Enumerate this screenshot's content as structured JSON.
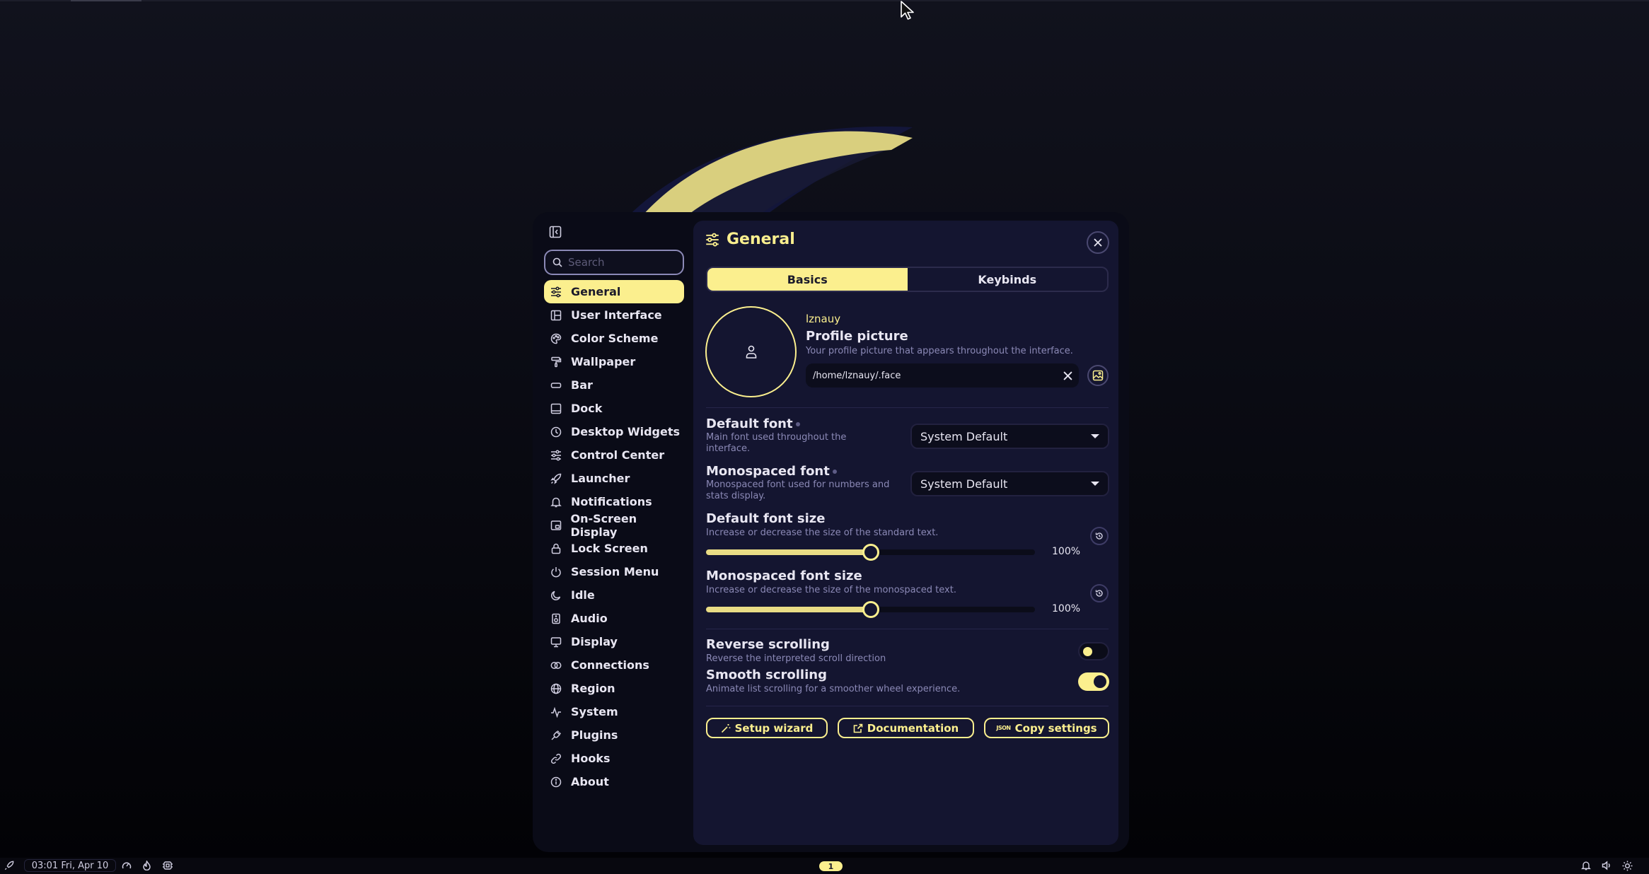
{
  "sidebar": {
    "search": {
      "placeholder": "Search"
    },
    "items": [
      {
        "label": "General",
        "icon": "sliders-icon"
      },
      {
        "label": "User Interface",
        "icon": "layout-icon"
      },
      {
        "label": "Color Scheme",
        "icon": "palette-icon"
      },
      {
        "label": "Wallpaper",
        "icon": "brush-icon"
      },
      {
        "label": "Bar",
        "icon": "bar-icon"
      },
      {
        "label": "Dock",
        "icon": "dock-icon"
      },
      {
        "label": "Desktop Widgets",
        "icon": "clock-icon"
      },
      {
        "label": "Control Center",
        "icon": "sliders-icon"
      },
      {
        "label": "Launcher",
        "icon": "rocket-icon"
      },
      {
        "label": "Notifications",
        "icon": "bell-icon"
      },
      {
        "label": "On-Screen Display",
        "icon": "osd-icon"
      },
      {
        "label": "Lock Screen",
        "icon": "lock-icon"
      },
      {
        "label": "Session Menu",
        "icon": "power-icon"
      },
      {
        "label": "Idle",
        "icon": "moon-icon"
      },
      {
        "label": "Audio",
        "icon": "speaker-icon"
      },
      {
        "label": "Display",
        "icon": "monitor-icon"
      },
      {
        "label": "Connections",
        "icon": "link-icon"
      },
      {
        "label": "Region",
        "icon": "globe-icon"
      },
      {
        "label": "System",
        "icon": "pulse-icon"
      },
      {
        "label": "Plugins",
        "icon": "plug-icon"
      },
      {
        "label": "Hooks",
        "icon": "chain-icon"
      },
      {
        "label": "About",
        "icon": "info-icon"
      }
    ]
  },
  "header": {
    "title": "General"
  },
  "tabs": [
    {
      "label": "Basics"
    },
    {
      "label": "Keybinds"
    }
  ],
  "profile": {
    "username": "lznauy",
    "title": "Profile picture",
    "description": "Your profile picture that appears throughout the interface.",
    "path": "/home/lznauy/.face"
  },
  "settings": {
    "default_font": {
      "label": "Default font",
      "desc": "Main font used throughout the interface.",
      "value": "System Default"
    },
    "mono_font": {
      "label": "Monospaced font",
      "desc": "Monospaced font used for numbers and stats display.",
      "value": "System Default"
    },
    "default_font_size": {
      "label": "Default font size",
      "desc": "Increase or decrease the size of the standard text.",
      "value_text": "100%",
      "level": 0.5
    },
    "mono_font_size": {
      "label": "Monospaced font size",
      "desc": "Increase or decrease the size of the monospaced text.",
      "value_text": "100%",
      "level": 0.5
    },
    "reverse_scrolling": {
      "label": "Reverse scrolling",
      "desc": "Reverse the interpreted scroll direction",
      "on": false
    },
    "smooth_scrolling": {
      "label": "Smooth scrolling",
      "desc": "Animate list scrolling for a smoother wheel experience.",
      "on": true
    }
  },
  "actions": {
    "setup": "Setup wizard",
    "docs": "Documentation",
    "copy": "Copy settings",
    "copy_icon_text": "JSON"
  },
  "taskbar": {
    "clock": "03:01 Fri, Apr 10",
    "workspace": "1"
  },
  "colors": {
    "accent": "#fbef8e",
    "panel": "#141530",
    "background": "#0a0b13"
  }
}
